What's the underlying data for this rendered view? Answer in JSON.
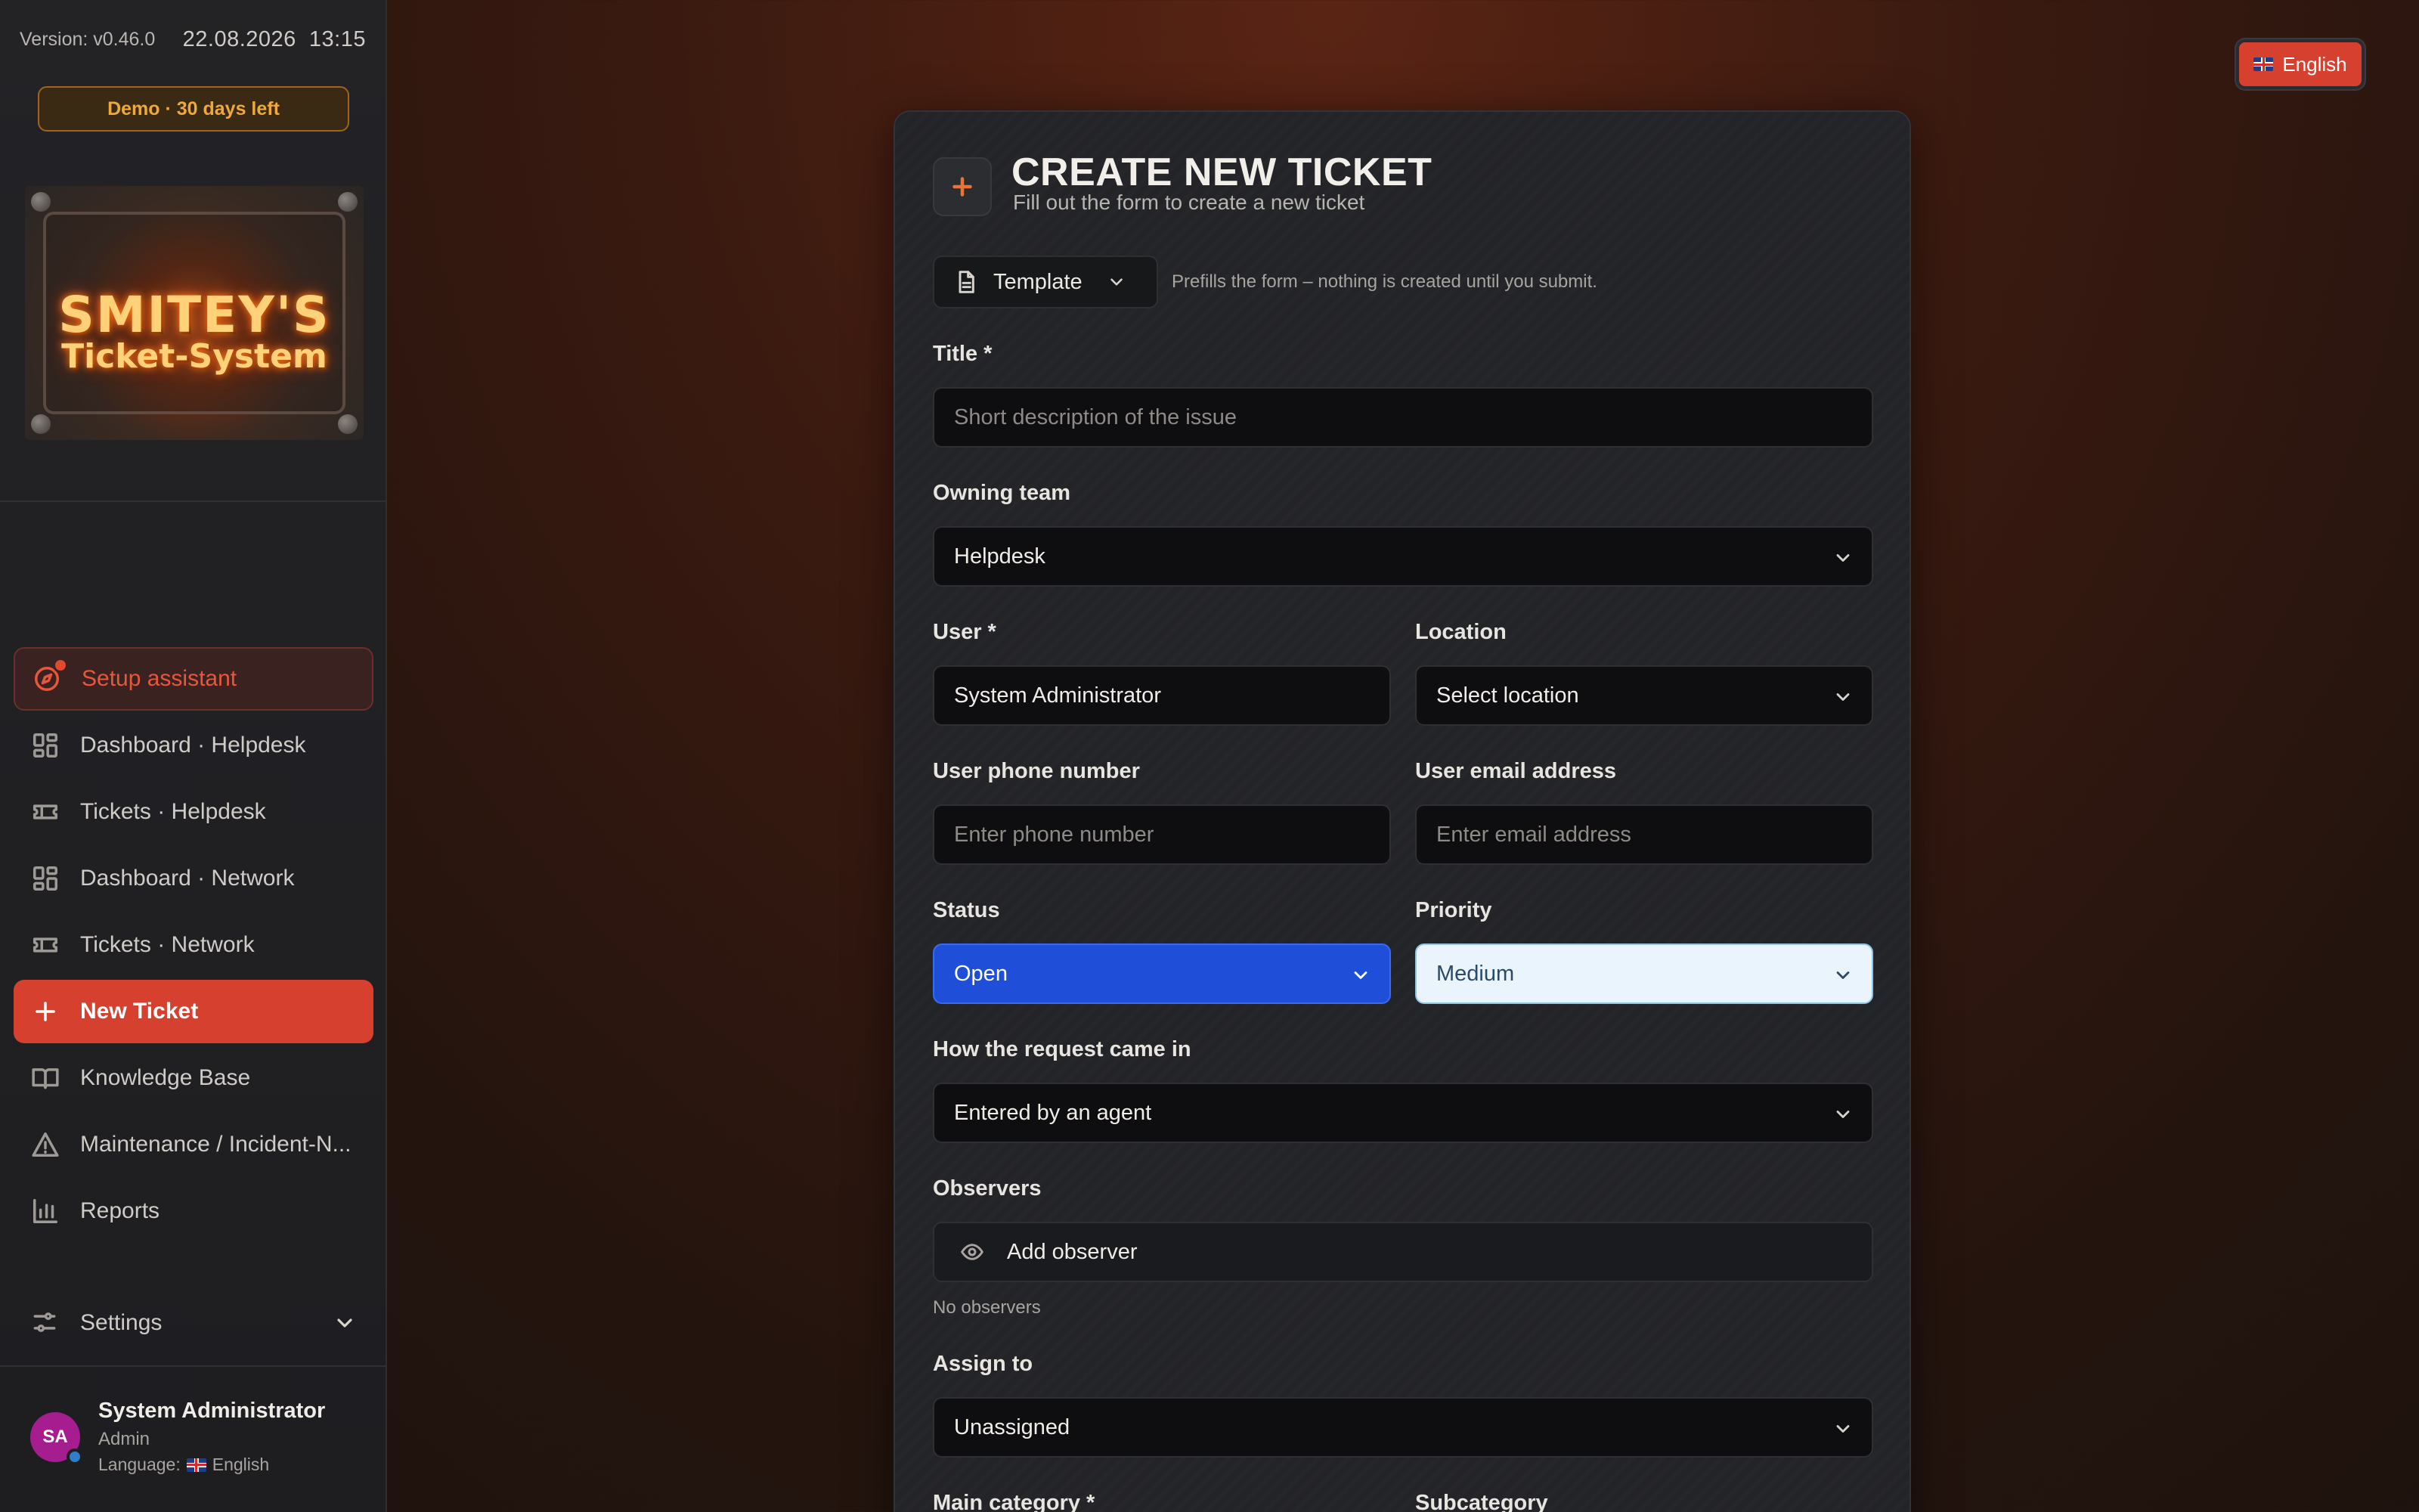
{
  "sidebar": {
    "version": "Version: v0.46.0",
    "date": "22.08.2026",
    "time": "13:15",
    "demo_badge": "Demo · 30 days left",
    "logo": {
      "line1": "SMITEY'S",
      "line2": "Ticket-System"
    },
    "nav": [
      {
        "label": "Setup assistant",
        "icon": "compass-icon"
      },
      {
        "label": "Dashboard · Helpdesk",
        "icon": "dashboard-icon"
      },
      {
        "label": "Tickets · Helpdesk",
        "icon": "ticket-icon"
      },
      {
        "label": "Dashboard · Network",
        "icon": "dashboard-icon"
      },
      {
        "label": "Tickets · Network",
        "icon": "ticket-icon"
      },
      {
        "label": "New Ticket",
        "icon": "plus-icon"
      },
      {
        "label": "Knowledge Base",
        "icon": "book-icon"
      },
      {
        "label": "Maintenance / Incident-N...",
        "icon": "warning-icon"
      },
      {
        "label": "Reports",
        "icon": "bar-chart-icon"
      }
    ],
    "settings_label": "Settings",
    "user": {
      "initials": "SA",
      "name": "System Administrator",
      "role": "Admin",
      "language_label": "Language:",
      "language": "English"
    }
  },
  "language_button": "English",
  "form": {
    "title": "CREATE NEW TICKET",
    "subtitle": "Fill out the form to create a new ticket",
    "template_label": "Template",
    "template_hint": "Prefills the form – nothing is created until you submit.",
    "title_label": "Title *",
    "title_placeholder": "Short description of the issue",
    "owning_team_label": "Owning team",
    "owning_team_value": "Helpdesk",
    "user_label": "User *",
    "user_value": "System Administrator",
    "location_label": "Location",
    "location_value": "Select location",
    "phone_label": "User phone number",
    "phone_placeholder": "Enter phone number",
    "email_label": "User email address",
    "email_placeholder": "Enter email address",
    "status_label": "Status",
    "status_value": "Open",
    "priority_label": "Priority",
    "priority_value": "Medium",
    "channel_label": "How the request came in",
    "channel_value": "Entered by an agent",
    "observers_label": "Observers",
    "add_observer": "Add observer",
    "no_observers": "No observers",
    "assign_label": "Assign to",
    "assign_value": "Unassigned",
    "main_category_label": "Main category *",
    "subcategory_label": "Subcategory"
  },
  "colors": {
    "accent": "#d5402f",
    "status_open": "#1f4fd8",
    "priority_medium_bg": "#eaf4fc",
    "demo_badge": "#f0a83a"
  }
}
